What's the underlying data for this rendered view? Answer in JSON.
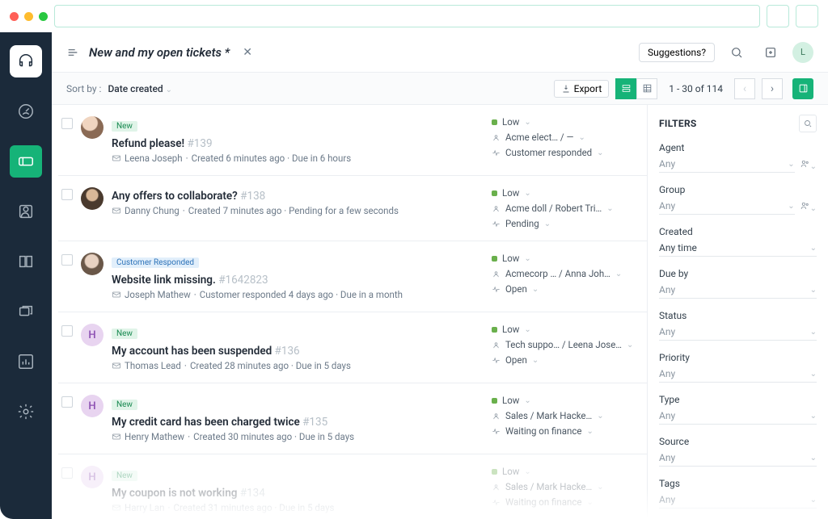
{
  "topbar": {
    "title": "New and my open tickets *",
    "suggestions_label": "Suggestions?",
    "avatar_initial": "L"
  },
  "toolbar": {
    "sort_label": "Sort by :",
    "sort_value": "Date created",
    "export_label": "Export",
    "pagination": "1 - 30 of 114"
  },
  "tickets": [
    {
      "badge": "New",
      "badge_type": "new",
      "title": "Refund please!",
      "id": "#139",
      "agent": "Leena Joseph",
      "meta": "Created 6 minutes ago  ·  Due in 6 hours",
      "priority": "Low",
      "company": "Acme elect… / —",
      "status": "Customer responded",
      "avatar": "photo1"
    },
    {
      "badge": "",
      "badge_type": "",
      "title": "Any offers to collaborate?",
      "id": "#138",
      "agent": "Danny Chung",
      "meta": "Created 7 minutes ago  ·  Pending for a few seconds",
      "priority": "Low",
      "company": "Acme doll / Robert Tri…",
      "status": "Pending",
      "avatar": "photo2"
    },
    {
      "badge": "Customer Responded",
      "badge_type": "resp",
      "title": "Website link missing.",
      "id": "#1642823",
      "agent": "Joseph Mathew",
      "meta": "Customer responded 4 days ago  ·  Due in a month",
      "priority": "Low",
      "company": "Acmecorp … / Anna Joh…",
      "status": "Open",
      "avatar": "photo3"
    },
    {
      "badge": "New",
      "badge_type": "new",
      "title": "My account has been suspended",
      "id": "#136",
      "agent": "Thomas Lead",
      "meta": "Created 28 minutes ago  ·  Due in 5 days",
      "priority": "Low",
      "company": "Tech suppo… / Leena Jose…",
      "status": "Open",
      "avatar": "H"
    },
    {
      "badge": "New",
      "badge_type": "new",
      "title": "My credit card has been charged twice",
      "id": "#135",
      "agent": "Henry Mathew",
      "meta": "Created 30 minutes ago  ·  Due in 5 days",
      "priority": "Low",
      "company": "Sales / Mark Hacke…",
      "status": "Waiting on finance",
      "avatar": "H"
    },
    {
      "badge": "New",
      "badge_type": "new",
      "title": "My coupon is not working",
      "id": "#134",
      "agent": "Harry Lan",
      "meta": "Created 31 minutes ago  ·  Due in 5 days",
      "priority": "Low",
      "company": "Sales / Mark Hacke…",
      "status": "Waiting on finance",
      "avatar": "H"
    }
  ],
  "filters": {
    "title": "FILTERS",
    "items": [
      {
        "label": "Agent",
        "value": "Any",
        "extra_icon": true
      },
      {
        "label": "Group",
        "value": "Any",
        "extra_icon": true
      },
      {
        "label": "Created",
        "value": "Any time",
        "has_value": true
      },
      {
        "label": "Due by",
        "value": "Any"
      },
      {
        "label": "Status",
        "value": "Any"
      },
      {
        "label": "Priority",
        "value": "Any"
      },
      {
        "label": "Type",
        "value": "Any"
      },
      {
        "label": "Source",
        "value": "Any"
      },
      {
        "label": "Tags",
        "value": "Any"
      }
    ]
  }
}
